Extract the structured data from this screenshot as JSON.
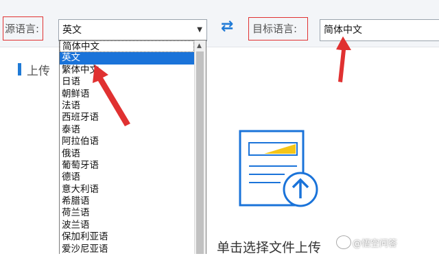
{
  "toolbar": {
    "source_label": "源语言:",
    "source_value": "英文",
    "target_label": "目标语言:",
    "target_value": "简体中文",
    "swap_icon": "swap-arrows-icon"
  },
  "section": {
    "title": "上传"
  },
  "dropdown": {
    "items": [
      "简体中文",
      "英文",
      "繁体中文",
      "日语",
      "朝鲜语",
      "法语",
      "西班牙语",
      "泰语",
      "阿拉伯语",
      "俄语",
      "葡萄牙语",
      "德语",
      "意大利语",
      "希腊语",
      "荷兰语",
      "波兰语",
      "保加利亚语",
      "爱沙尼亚语"
    ],
    "selected_index": 1
  },
  "upload": {
    "label": "单击选择文件上传",
    "icon": "document-upload-icon"
  },
  "watermark": {
    "text": "@悟空问答"
  },
  "colors": {
    "accent": "#1a73d9",
    "annotation": "#e03131",
    "doc_bar": "#f5c518"
  }
}
